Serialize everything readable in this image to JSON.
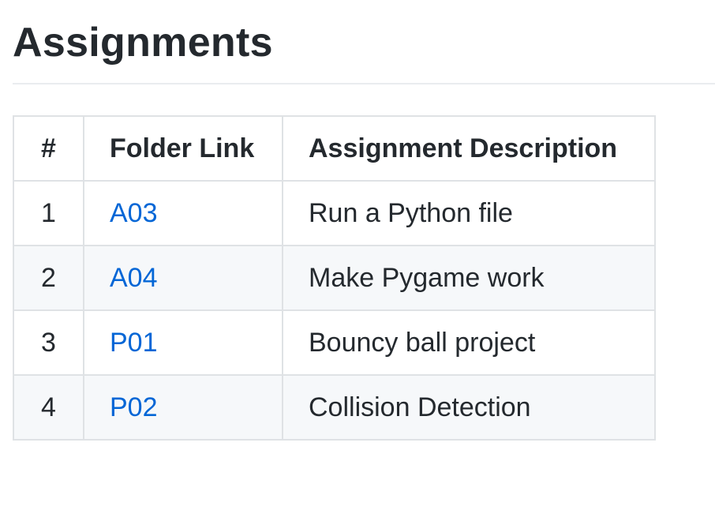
{
  "page": {
    "title": "Assignments"
  },
  "table": {
    "headers": {
      "number": "#",
      "folder": "Folder Link",
      "description": "Assignment Description"
    },
    "rows": [
      {
        "number": "1",
        "folder": "A03",
        "description": "Run a Python file"
      },
      {
        "number": "2",
        "folder": "A04",
        "description": "Make Pygame work"
      },
      {
        "number": "3",
        "folder": "P01",
        "description": "Bouncy ball project"
      },
      {
        "number": "4",
        "folder": "P02",
        "description": "Collision Detection"
      }
    ]
  },
  "colors": {
    "text": "#24292e",
    "link": "#0366d6",
    "border": "#dfe2e5",
    "stripe": "#f6f8fa",
    "rule": "#eaecef"
  }
}
